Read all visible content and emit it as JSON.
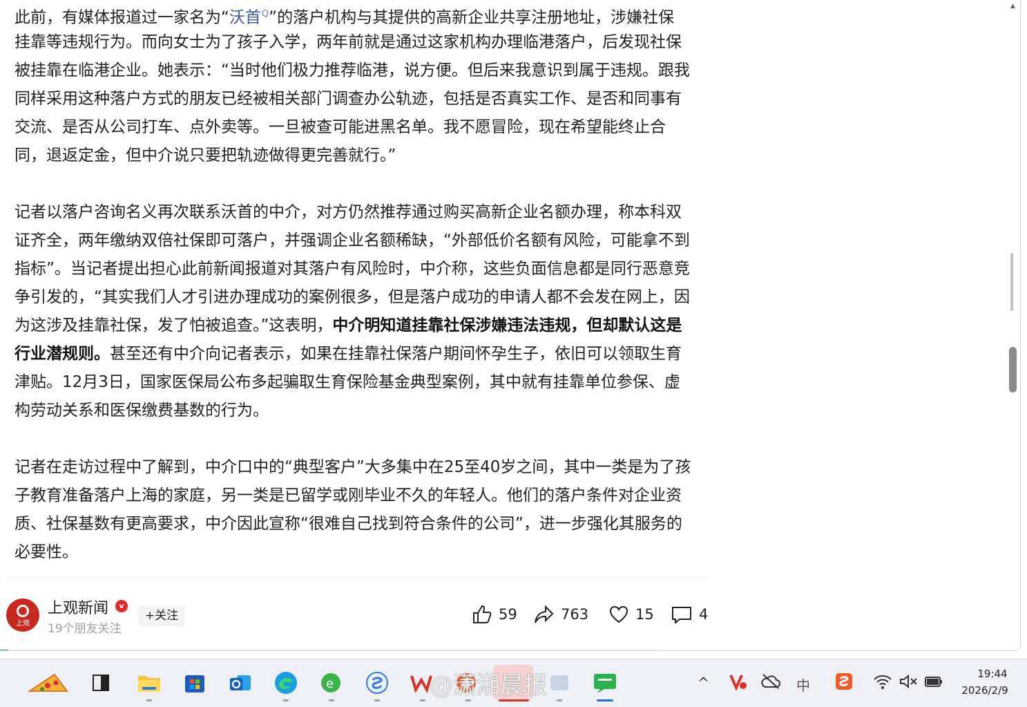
{
  "article": {
    "p1": [
      [
        "此前，有媒体报道过一家名为“",
        "沃首",
        "Q",
        "”的落户机构与其提供的高新企业共享注册地址，涉嫌社保"
      ],
      "挂靠等违规行为。而向女士为了孩子入学，两年前就是通过这家机构办理临港落户，后发现社保",
      "被挂靠在临港企业。她表示：“当时他们极力推荐临港，说方便。但后来我意识到属于违规。跟我",
      "同样采用这种落户方式的朋友已经被相关部门调查办公轨迹，包括是否真实工作、是否和同事有",
      "交流、是否从公司打车、点外卖等。一旦被查可能进黑名单。我不愿冒险，现在希望能终止合",
      "同，退返定金，但中介说只要把轨迹做得更完善就行。”"
    ],
    "p2": [
      "记者以落户咨询名义再次联系沃首的中介，对方仍然推荐通过购买高新企业名额办理，称本科双",
      "证齐全，两年缴纳双倍社保即可落户，并强调企业名额稀缺，“外部低价名额有风险，可能拿不到",
      "指标”。当记者提出担心此前新闻报道对其落户有风险时，中介称，这些负面信息都是同行恶意竞",
      "争引发的，“其实我们人才引进办理成功的案例很多，但是落户成功的申请人都不会发在网上，因",
      [
        "为这涉及挂靠社保，发了怕被追查。”这表明，",
        "中介明知道挂靠社保涉嫌违法违规，但却默认这是"
      ],
      [
        "行业潜规则。",
        "甚至还有中介向记者表示，如果在挂靠社保落户期间怀孕生子，依旧可以领取生育"
      ],
      "津贴。12月3日，国家医保局公布多起骗取生育保险基金典型案例，其中就有挂靠单位参保、虚",
      "构劳动关系和医保缴费基数的行为。"
    ],
    "p3": [
      "记者在走访过程中了解到，中介口中的“典型客户”大多集中在25至40岁之间，其中一类是为了孩",
      "子教育准备落户上海的家庭，另一类是已留学或刚毕业不久的年轻人。他们的落户条件对企业资",
      "质、社保基数有更高要求，中介因此宣称“很难自己找到符合条件的公司”，进一步强化其服务的",
      "必要性。"
    ]
  },
  "footer": {
    "source_name": "上观新闻",
    "avatar_text": "上观",
    "verified_mark": "v",
    "followers": "19个朋友关注",
    "follow_label": "+关注",
    "likes": "59",
    "shares": "763",
    "favorites": "15",
    "comments": "4",
    "read_progress": 0.64
  },
  "taskbar": {
    "watermark": "@潇湘晨报",
    "tray_ime": "中",
    "tray_v": "V",
    "tray_s": "S",
    "tray_up": "^",
    "clock_time": "19:44",
    "clock_date": "2026/2/9"
  },
  "colors": {
    "link": "#3c5a99",
    "accent_green": "#1aa34a",
    "verified_red": "#e3262b",
    "avatar_red": "#c8281f"
  }
}
